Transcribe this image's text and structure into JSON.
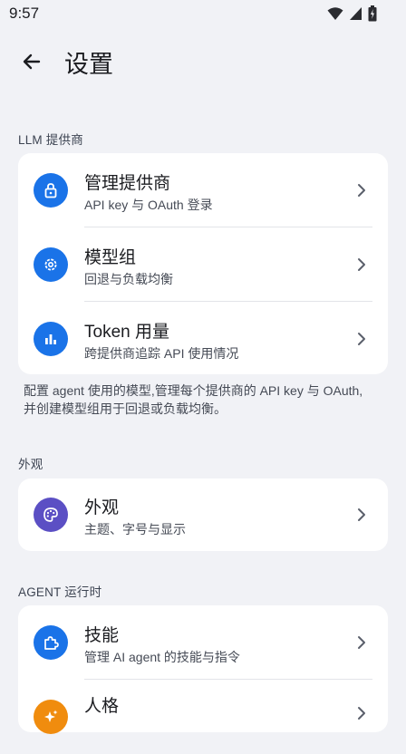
{
  "status_bar": {
    "time": "9:57",
    "icons": [
      "wifi-icon",
      "signal-icon",
      "battery-icon"
    ]
  },
  "app_bar": {
    "back_icon": "arrow-back-icon",
    "title": "设置"
  },
  "sections": {
    "llm": {
      "header": "LLM 提供商",
      "items": [
        {
          "title": "管理提供商",
          "subtitle": "API key 与 OAuth 登录",
          "icon": "lock-icon",
          "color": "#1a73e8"
        },
        {
          "title": "模型组",
          "subtitle": "回退与负载均衡",
          "icon": "gear-icon",
          "color": "#1a73e8"
        },
        {
          "title": "Token 用量",
          "subtitle": "跨提供商追踪 API 使用情况",
          "icon": "bar-chart-icon",
          "color": "#1a73e8"
        }
      ],
      "description": "配置 agent 使用的模型,管理每个提供商的 API key 与 OAuth,并创建模型组用于回退或负载均衡。"
    },
    "appearance": {
      "header": "外观",
      "items": [
        {
          "title": "外观",
          "subtitle": "主题、字号与显示",
          "icon": "palette-icon",
          "color": "#5b4fc4"
        }
      ]
    },
    "agent": {
      "header": "AGENT 运行时",
      "items": [
        {
          "title": "技能",
          "subtitle": "管理 AI agent 的技能与指令",
          "icon": "puzzle-icon",
          "color": "#1a73e8"
        },
        {
          "title": "人格",
          "subtitle": "",
          "icon": "sparkle-icon",
          "color": "#f08c0e"
        }
      ]
    }
  }
}
